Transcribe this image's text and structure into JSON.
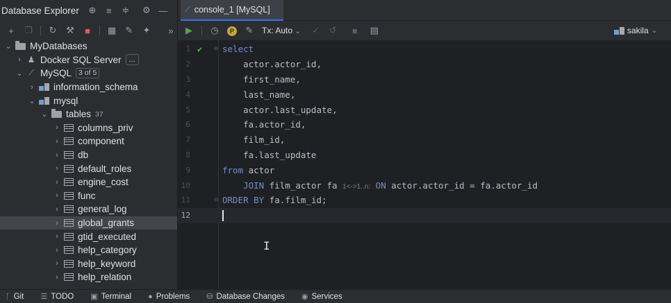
{
  "left_panel": {
    "title": "Database Explorer",
    "header_icons": [
      "crosshair-icon",
      "expand-all-icon",
      "collapse-all-icon",
      "gear-icon",
      "hide-icon"
    ],
    "toolbar_icons": [
      "add-icon",
      "copy-icon",
      "refresh-icon",
      "edit-datasource-icon",
      "stop-icon",
      "table-view-icon",
      "edit-icon",
      "jump-to-icon"
    ],
    "tree": {
      "root": "MyDatabases",
      "docker": "Docker SQL Server",
      "docker_more": "...",
      "mysql": "MySQL",
      "mysql_badge": "3 of 5",
      "information_schema": "information_schema",
      "mysql_schema": "mysql",
      "tables": "tables",
      "tables_count": "37",
      "table_items": [
        "columns_priv",
        "component",
        "db",
        "default_roles",
        "engine_cost",
        "func",
        "general_log",
        "global_grants",
        "gtid_executed",
        "help_category",
        "help_keyword",
        "help_relation"
      ],
      "selected_table": "global_grants"
    }
  },
  "tabbar": {
    "active_tab": "console_1 [MySQL]"
  },
  "editor_toolbar": {
    "tx_label": "Tx: Auto",
    "schema": "sakila",
    "p_label": "P"
  },
  "editor": {
    "line_numbers": [
      "1",
      "2",
      "3",
      "4",
      "5",
      "6",
      "7",
      "8",
      "9",
      "10",
      "11",
      "12"
    ],
    "lines": [
      "select",
      "    actor.actor_id,",
      "    first_name,",
      "    last_name,",
      "    actor.last_update,",
      "    fa.actor_id,",
      "    film_id,",
      "    fa.last_update",
      "from actor",
      "    JOIN film_actor fa",
      "ORDER BY fa.film_id;",
      ""
    ],
    "join_hint": "1<->1..n:",
    "join_tail": " ON actor.actor_id = fa.actor_id",
    "current_line": 12
  },
  "statusbar": {
    "git": "Git",
    "todo": "TODO",
    "terminal": "Terminal",
    "problems": "Problems",
    "database_changes": "Database Changes",
    "services": "Services"
  },
  "colors": {
    "accent": "#3574f0",
    "keyword": "#6f8fc8",
    "run_green": "#57a64a",
    "stop_red": "#db5c5c"
  }
}
